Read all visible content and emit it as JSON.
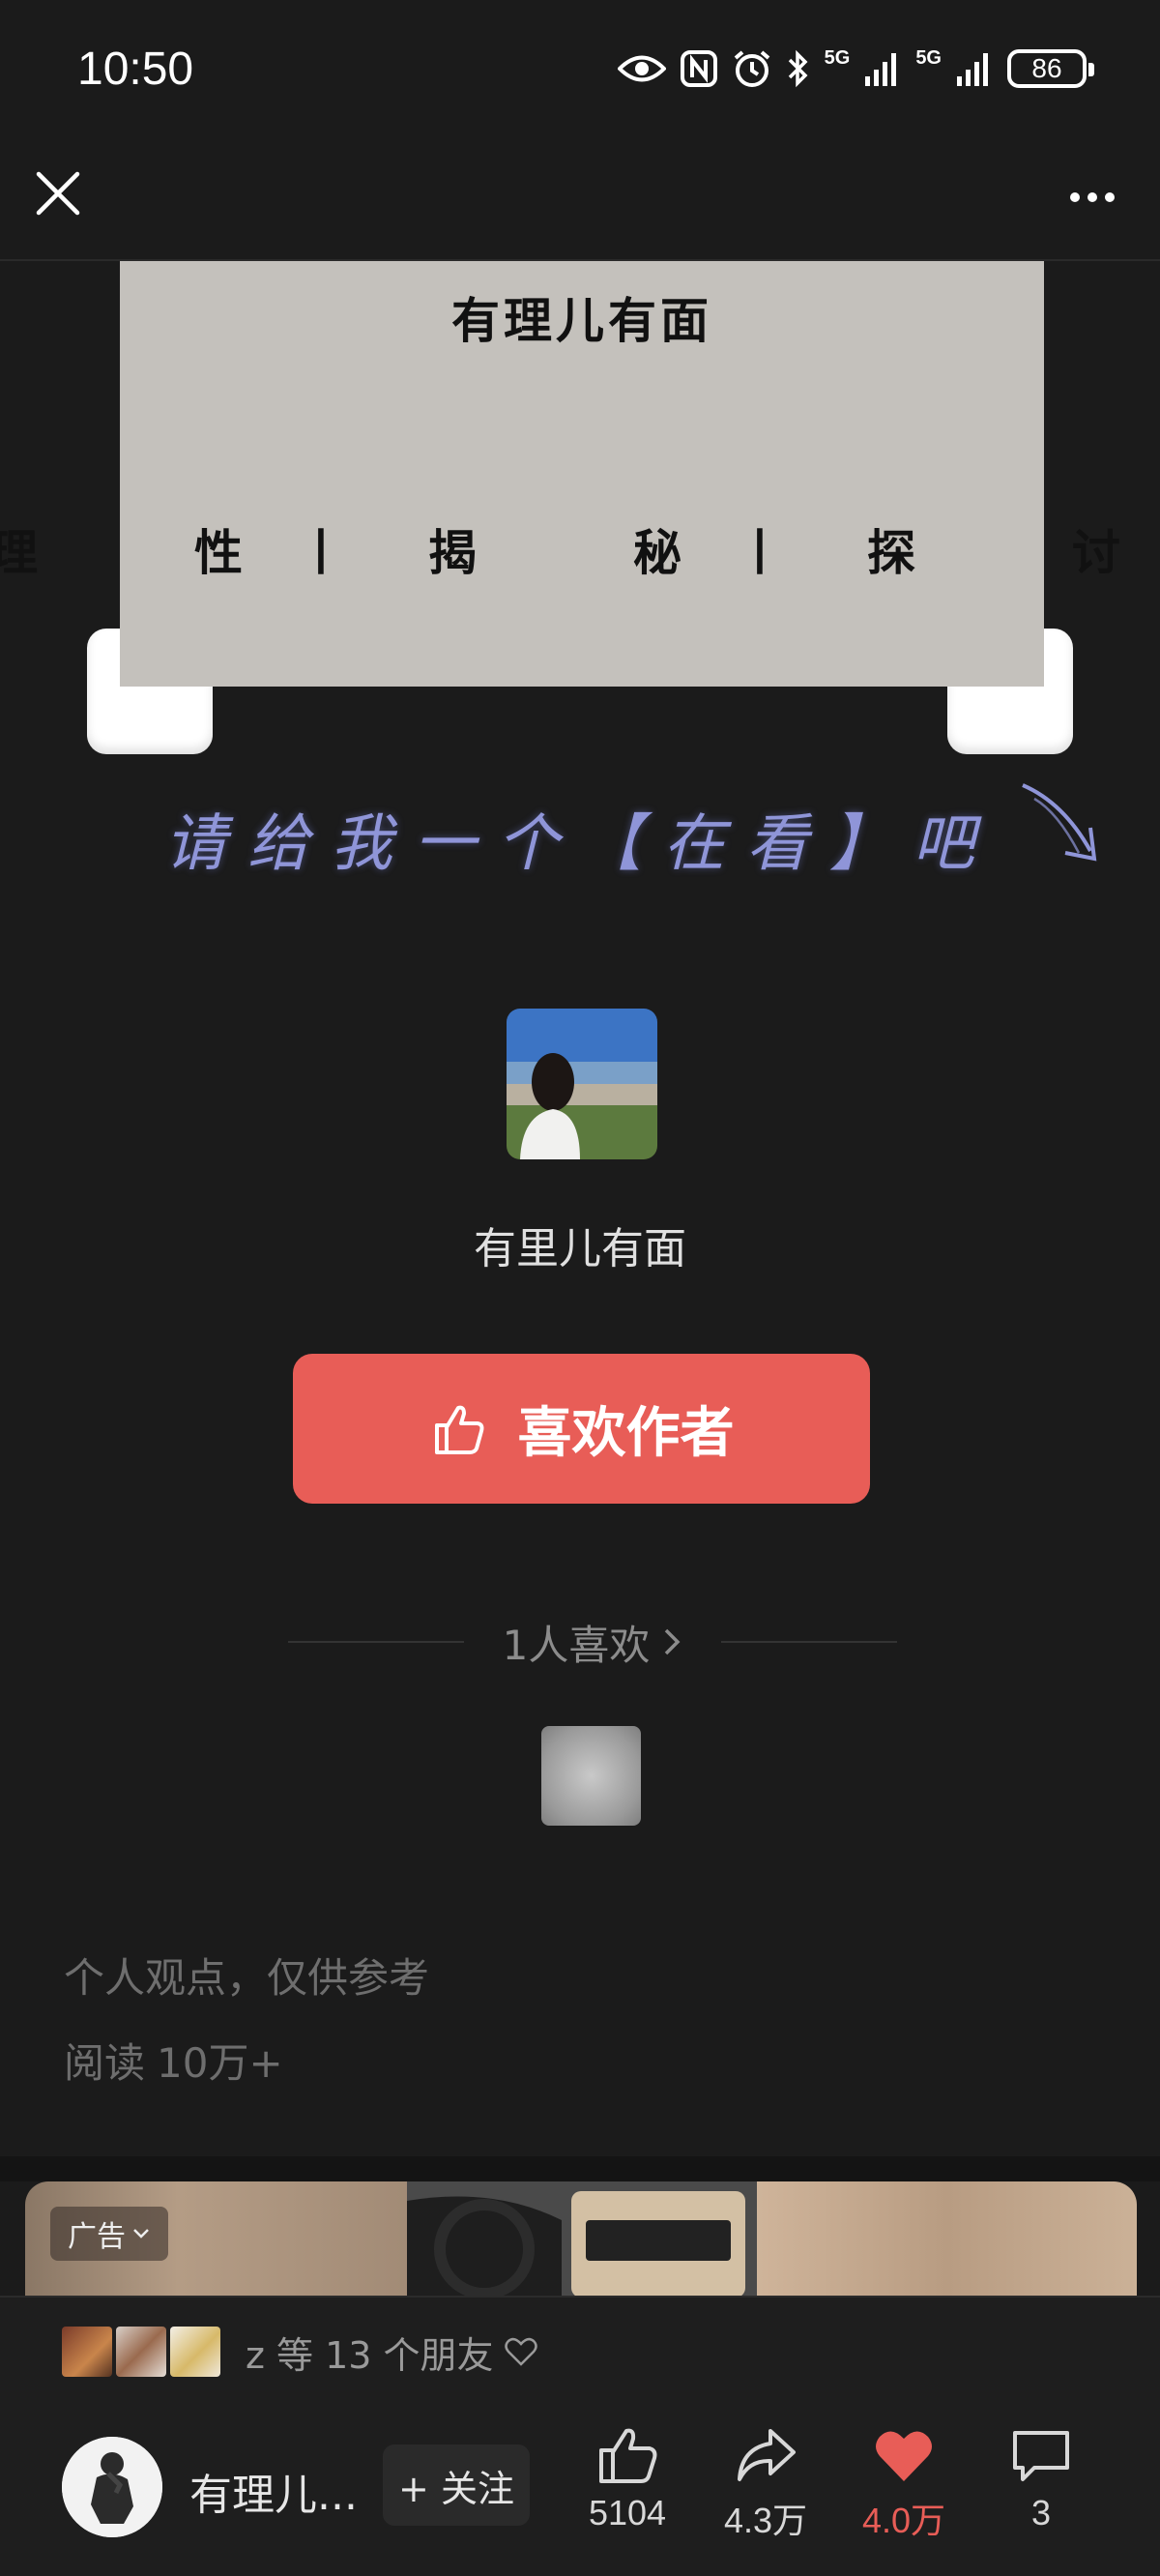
{
  "status_bar": {
    "time": "10:50",
    "network_1": "5G",
    "network_2": "5G",
    "battery": "86"
  },
  "nav": {
    "close_icon": "close-icon",
    "more_icon": "more-dots-icon"
  },
  "banner": {
    "title": "有理儿有面",
    "tags": [
      "理　性丨",
      "揭　秘丨",
      "探　讨"
    ],
    "background": "#c4c1bc"
  },
  "cta": {
    "text": "请给我一个【在看】吧"
  },
  "author": {
    "name": "有里儿有面",
    "like_button_label": "喜欢作者",
    "likes_count_text": "1人喜欢",
    "accent": "#e85d57"
  },
  "article_meta": {
    "disclaimer": "个人观点，仅供参考",
    "reads_label": "阅读",
    "reads_value": "10万+"
  },
  "ad": {
    "badge": "广告"
  },
  "bottom_bar": {
    "friends_text": "z 等 13 个朋友",
    "account_name": "有理儿...",
    "follow_label": "+ 关注",
    "actions": [
      {
        "name": "like",
        "icon": "thumbs-up-icon",
        "value": "5104"
      },
      {
        "name": "share",
        "icon": "share-icon",
        "value": "4.3万"
      },
      {
        "name": "favorite",
        "icon": "heart-icon",
        "value": "4.0万"
      },
      {
        "name": "comment",
        "icon": "comment-icon",
        "value": "3"
      }
    ]
  }
}
